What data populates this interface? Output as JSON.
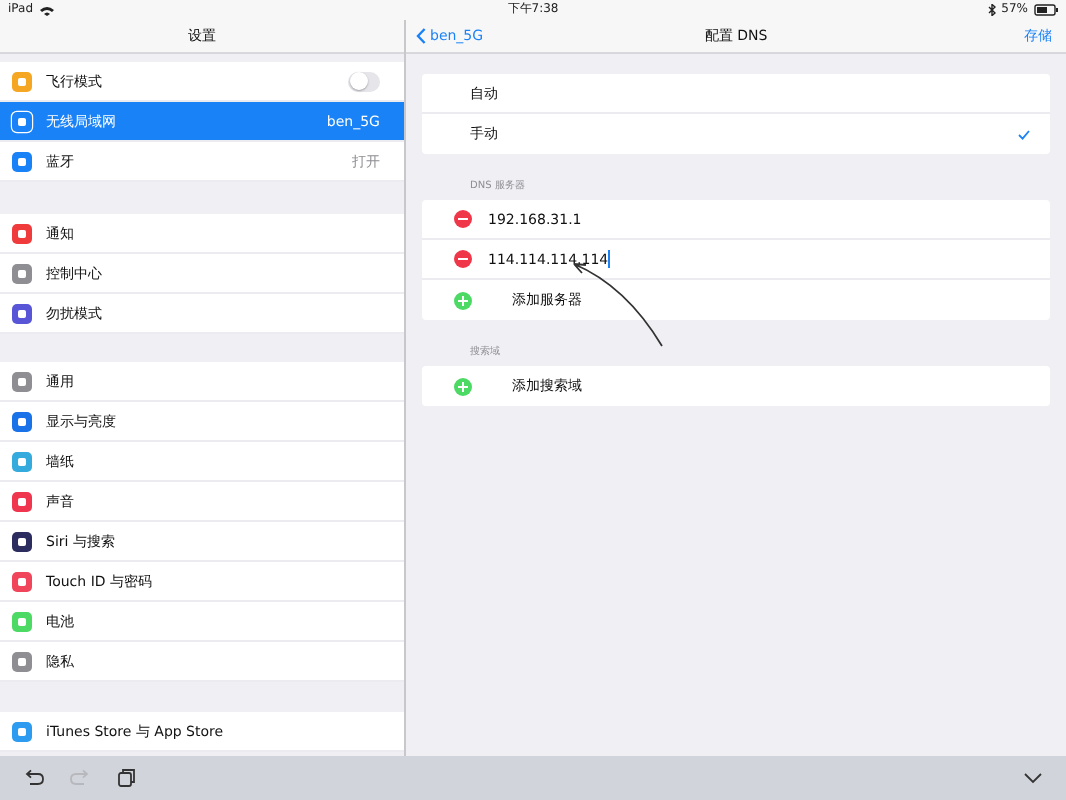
{
  "status_bar": {
    "device": "iPad",
    "time": "下午7:38",
    "battery": "57%"
  },
  "sidebar": {
    "title": "设置",
    "groups": [
      [
        {
          "label": "飞行模式",
          "color": "#f5a623",
          "on": false,
          "selected": false
        },
        {
          "label": "无线局域网",
          "color": "#1a82f7",
          "value": "ben_5G",
          "selected": true
        },
        {
          "label": "蓝牙",
          "color": "#1a82f7",
          "value": "打开",
          "selected": false
        }
      ],
      [
        {
          "label": "通知",
          "color": "#ef3b3b",
          "selected": false
        },
        {
          "label": "控制中心",
          "color": "#8e8e93",
          "selected": false
        },
        {
          "label": "勿扰模式",
          "color": "#5856d6",
          "selected": false
        }
      ],
      [
        {
          "label": "通用",
          "color": "#8e8e93",
          "selected": false
        },
        {
          "label": "显示与亮度",
          "color": "#1a72e8",
          "selected": false
        },
        {
          "label": "墙纸",
          "color": "#35aadc",
          "selected": false
        },
        {
          "label": "声音",
          "color": "#f0354f",
          "selected": false
        },
        {
          "label": "Siri 与搜索",
          "color": "#2c2c5e",
          "selected": false
        },
        {
          "label": "Touch ID 与密码",
          "color": "#f0455a",
          "selected": false
        },
        {
          "label": "电池",
          "color": "#4cd964",
          "selected": false
        },
        {
          "label": "隐私",
          "color": "#8e8e93",
          "selected": false
        }
      ],
      [
        {
          "label": "iTunes Store 与 App Store",
          "color": "#2d9cf0",
          "selected": false
        }
      ]
    ]
  },
  "detail": {
    "back": "ben_5G",
    "title": "配置 DNS",
    "action": "存储",
    "modes": [
      {
        "label": "自动",
        "selected": false
      },
      {
        "label": "手动",
        "selected": true
      }
    ],
    "sections": [
      {
        "header": "DNS 服务器",
        "rows": [
          {
            "kind": "remove",
            "text": "192.168.31.1",
            "editing": false
          },
          {
            "kind": "remove",
            "text": "114.114.114.114",
            "editing": true
          },
          {
            "kind": "add",
            "text": "添加服务器",
            "editing": false
          }
        ]
      },
      {
        "header": "搜索域",
        "rows": [
          {
            "kind": "add",
            "text": "添加搜索域",
            "editing": false
          }
        ]
      }
    ]
  },
  "toolbar": {
    "buttons": [
      {
        "kind": "undo",
        "disabled": false
      },
      {
        "kind": "redo",
        "disabled": true
      },
      {
        "kind": "paste",
        "disabled": false
      }
    ]
  }
}
